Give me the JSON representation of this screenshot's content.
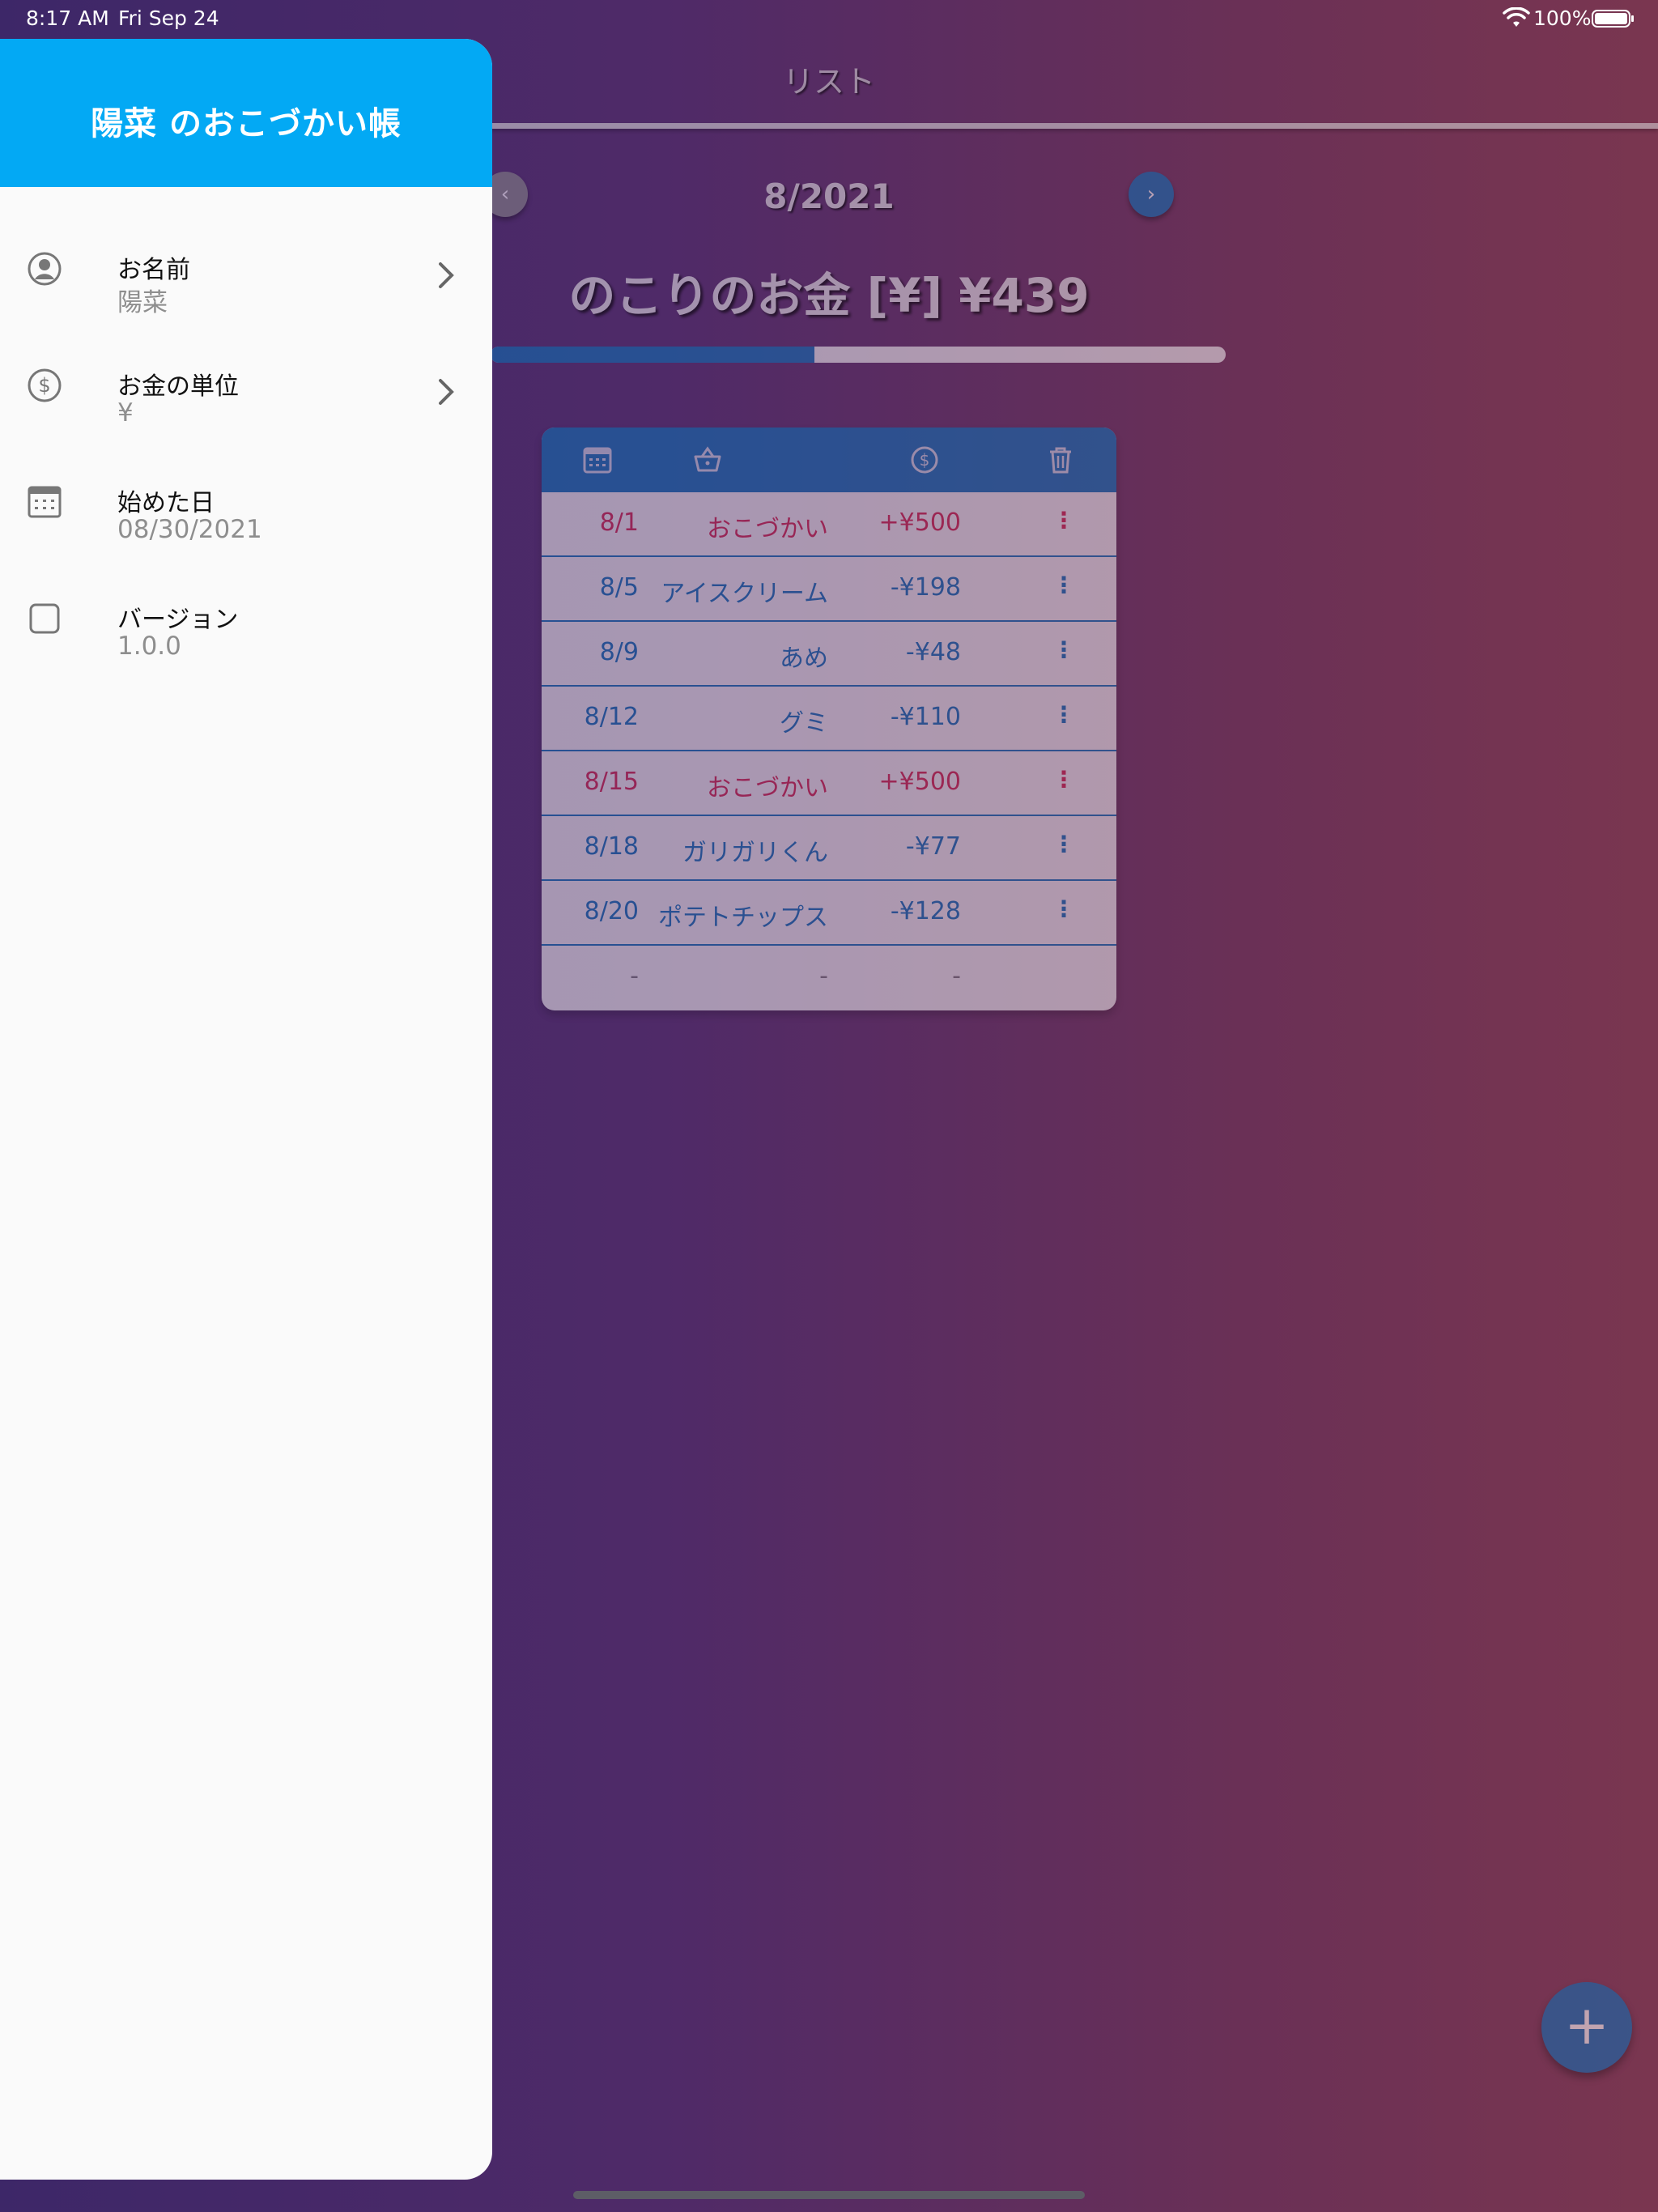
{
  "status_bar": {
    "time": "8:17 AM",
    "date": "Fri Sep 24",
    "battery": "100%"
  },
  "app_bar": {
    "title": "リスト"
  },
  "month": {
    "label": "8/2021",
    "prev_icon": "chevron-left-icon",
    "next_icon": "chevron-right-icon"
  },
  "summary": {
    "remaining": "のこりのお金 [¥] ¥439",
    "progress_fraction": 0.44
  },
  "table": {
    "header_icons": [
      "calendar-icon",
      "basket-icon",
      "dollar-icon",
      "trash-icon"
    ],
    "rows": [
      {
        "date": "8/1",
        "item": "おこづかい",
        "amount": "+¥500",
        "type": "income"
      },
      {
        "date": "8/5",
        "item": "アイスクリーム",
        "amount": "-¥198",
        "type": "expense"
      },
      {
        "date": "8/9",
        "item": "あめ",
        "amount": "-¥48",
        "type": "expense"
      },
      {
        "date": "8/12",
        "item": "グミ",
        "amount": "-¥110",
        "type": "expense"
      },
      {
        "date": "8/15",
        "item": "おこづかい",
        "amount": "+¥500",
        "type": "income"
      },
      {
        "date": "8/18",
        "item": "ガリガリくん",
        "amount": "-¥77",
        "type": "expense"
      },
      {
        "date": "8/20",
        "item": "ポテトチップス",
        "amount": "-¥128",
        "type": "expense"
      },
      {
        "date": "-",
        "item": "-",
        "amount": "-",
        "type": "empty"
      }
    ],
    "colors": {
      "income": "#d0234a",
      "expense": "#0a6fb5"
    }
  },
  "fab": {
    "label": "+"
  },
  "drawer": {
    "title": "陽菜 のおこづかい帳",
    "items": [
      {
        "icon": "user-circle-icon",
        "title": "お名前",
        "subtitle": "陽菜",
        "chevron": true
      },
      {
        "icon": "dollar-circle-icon",
        "title": "お金の単位",
        "subtitle": "¥",
        "chevron": true
      },
      {
        "icon": "calendar-icon",
        "title": "始めた日",
        "subtitle": "08/30/2021",
        "chevron": false
      },
      {
        "icon": "square-icon",
        "title": "バージョン",
        "subtitle": "1.0.0",
        "chevron": false
      }
    ]
  },
  "theme": {
    "accent": "#0a6fb5",
    "drawer_header": "#03a9f4"
  }
}
